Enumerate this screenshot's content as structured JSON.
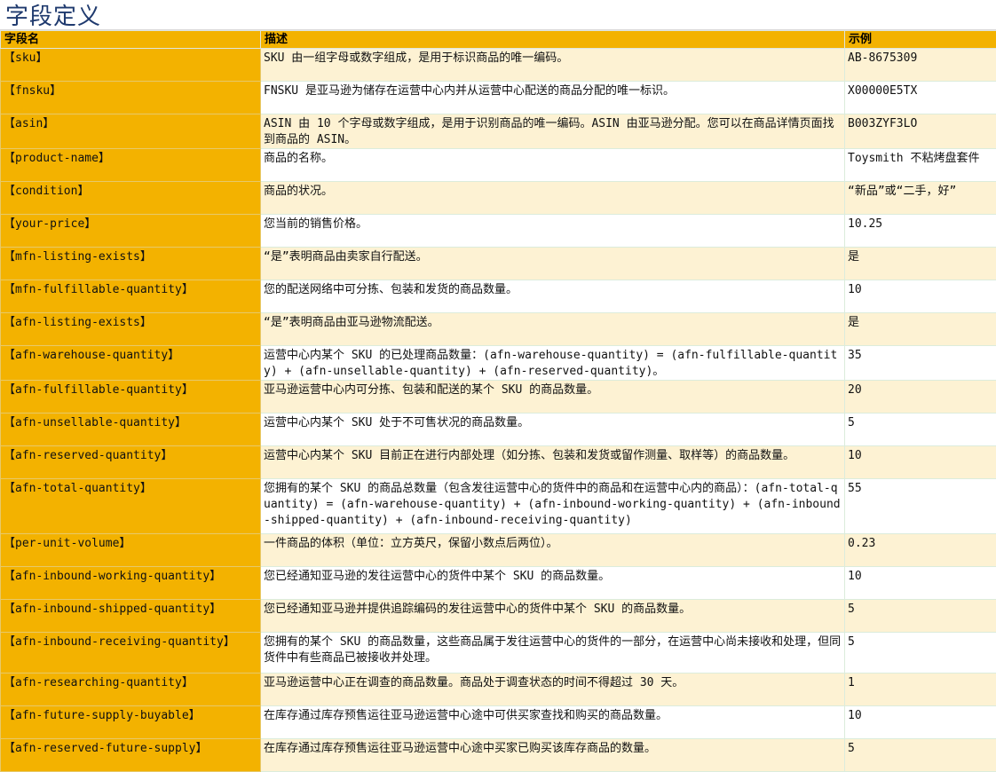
{
  "title": "字段定义",
  "headers": {
    "name": "字段名",
    "description": "描述",
    "example": "示例"
  },
  "rows": [
    {
      "name": "【sku】",
      "description": "SKU 由一组字母或数字组成，是用于标识商品的唯一编码。",
      "example": "AB-8675309"
    },
    {
      "name": "【fnsku】",
      "description": "FNSKU 是亚马逊为储存在运营中心内并从运营中心配送的商品分配的唯一标识。",
      "example": "X00000E5TX"
    },
    {
      "name": "【asin】",
      "description": "ASIN 由 10 个字母或数字组成，是用于识别商品的唯一编码。ASIN 由亚马逊分配。您可以在商品详情页面找到商品的 ASIN。",
      "example": "B003ZYF3LO"
    },
    {
      "name": "【product-name】",
      "description": "商品的名称。",
      "example": "Toysmith 不粘烤盘套件"
    },
    {
      "name": "【condition】",
      "description": "商品的状况。",
      "example": "“新品”或“二手，好”"
    },
    {
      "name": "【your-price】",
      "description": "您当前的销售价格。",
      "example": "10.25"
    },
    {
      "name": "【mfn-listing-exists】",
      "description": "“是”表明商品由卖家自行配送。",
      "example": "是"
    },
    {
      "name": "【mfn-fulfillable-quantity】",
      "description": "您的配送网络中可分拣、包装和发货的商品数量。",
      "example": "10"
    },
    {
      "name": "【afn-listing-exists】",
      "description": "“是”表明商品由亚马逊物流配送。",
      "example": "是"
    },
    {
      "name": "【afn-warehouse-quantity】",
      "description": "运营中心内某个 SKU 的已处理商品数量：(afn-warehouse-quantity) = (afn-fulfillable-quantity) + (afn-unsellable-quantity) + (afn-reserved-quantity)。",
      "example": "35"
    },
    {
      "name": "【afn-fulfillable-quantity】",
      "description": "亚马逊运营中心内可分拣、包装和配送的某个 SKU 的商品数量。",
      "example": "20"
    },
    {
      "name": "【afn-unsellable-quantity】",
      "description": "运营中心内某个 SKU 处于不可售状况的商品数量。",
      "example": "5"
    },
    {
      "name": "【afn-reserved-quantity】",
      "description": "运营中心内某个 SKU 目前正在进行内部处理（如分拣、包装和发货或留作测量、取样等）的商品数量。",
      "example": "10"
    },
    {
      "name": "【afn-total-quantity】",
      "description": "您拥有的某个 SKU 的商品总数量（包含发往运营中心的货件中的商品和在运营中心内的商品）：(afn-total-quantity) = (afn-warehouse-quantity) + (afn-inbound-working-quantity) + (afn-inbound-shipped-quantity) + (afn-inbound-receiving-quantity)",
      "example": "55"
    },
    {
      "name": "【per-unit-volume】",
      "description": "一件商品的体积（单位：立方英尺，保留小数点后两位）。",
      "example": "0.23"
    },
    {
      "name": "【afn-inbound-working-quantity】",
      "description": "您已经通知亚马逊的发往运营中心的货件中某个 SKU 的商品数量。",
      "example": "10"
    },
    {
      "name": "【afn-inbound-shipped-quantity】",
      "description": "您已经通知亚马逊并提供追踪编码的发往运营中心的货件中某个 SKU 的商品数量。",
      "example": "5"
    },
    {
      "name": "【afn-inbound-receiving-quantity】",
      "description": "您拥有的某个 SKU 的商品数量，这些商品属于发往运营中心的货件的一部分，在运营中心尚未接收和处理，但同货件中有些商品已被接收并处理。",
      "example": "5"
    },
    {
      "name": "【afn-researching-quantity】",
      "description": "亚马逊运营中心正在调查的商品数量。商品处于调查状态的时间不得超过 30 天。",
      "example": "1"
    },
    {
      "name": "【afn-future-supply-buyable】",
      "description": "在库存通过库存预售运往亚马逊运营中心途中可供买家查找和购买的商品数量。",
      "example": "10"
    },
    {
      "name": "【afn-reserved-future-supply】",
      "description": "在库存通过库存预售运往亚马逊运营中心途中买家已购买该库存商品的数量。",
      "example": "5"
    }
  ]
}
